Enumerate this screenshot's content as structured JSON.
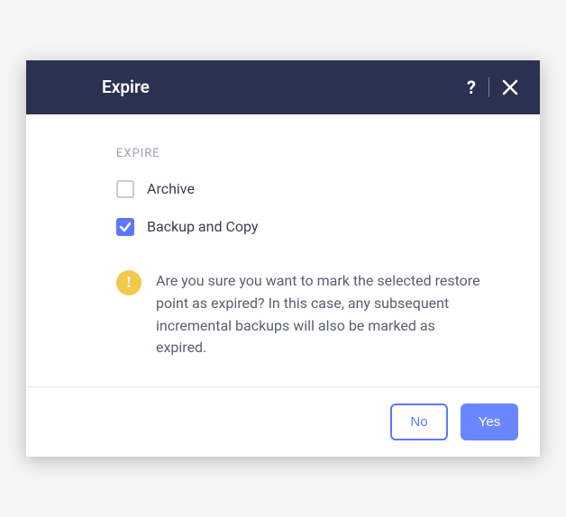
{
  "header": {
    "title": "Expire",
    "help_label": "?"
  },
  "body": {
    "section_label": "EXPIRE",
    "options": [
      {
        "label": "Archive",
        "checked": false
      },
      {
        "label": "Backup and Copy",
        "checked": true
      }
    ],
    "warning_text": "Are you sure you want to mark the selected restore point as expired? In this case, any subsequent incremental backups will also be marked as expired."
  },
  "footer": {
    "no_label": "No",
    "yes_label": "Yes"
  }
}
